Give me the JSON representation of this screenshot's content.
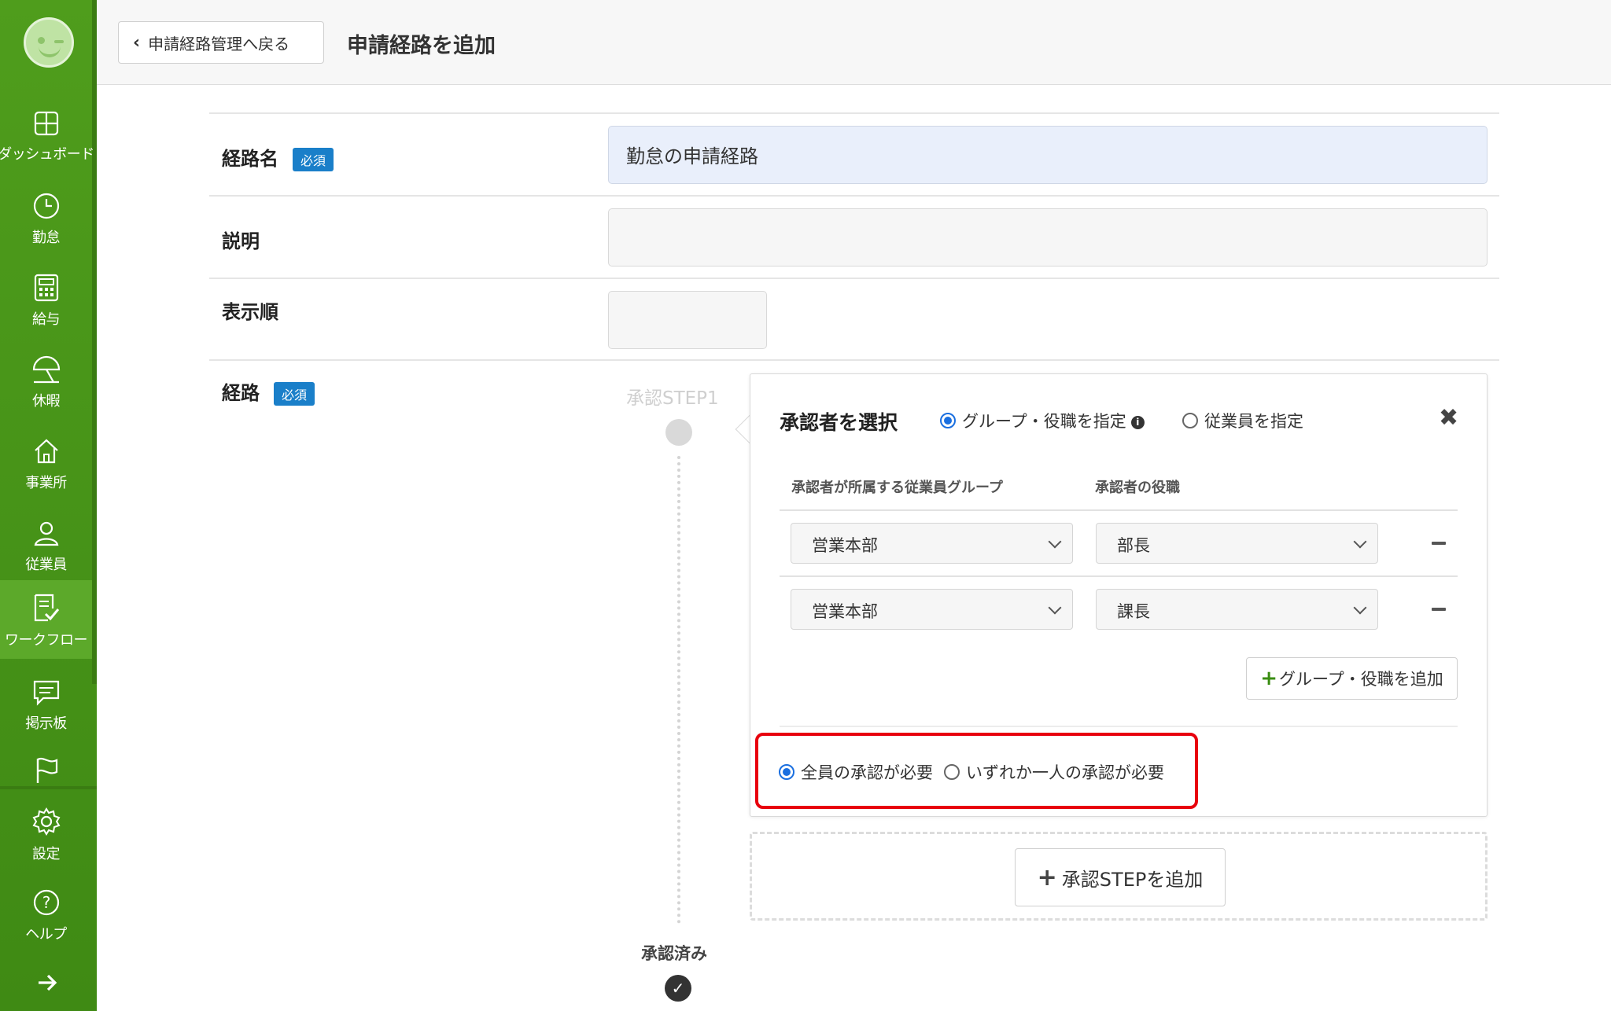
{
  "sidebar": {
    "items": [
      {
        "label": "ダッシュボード",
        "icon": "dashboard-icon"
      },
      {
        "label": "勤怠",
        "icon": "clock-icon"
      },
      {
        "label": "給与",
        "icon": "calculator-icon"
      },
      {
        "label": "休暇",
        "icon": "umbrella-icon"
      },
      {
        "label": "事業所",
        "icon": "home-icon"
      },
      {
        "label": "従業員",
        "icon": "person-icon"
      },
      {
        "label": "ワークフロー",
        "icon": "workflow-icon"
      },
      {
        "label": "掲示板",
        "icon": "message-icon"
      },
      {
        "label": "設定",
        "icon": "gear-icon"
      },
      {
        "label": "ヘルプ",
        "icon": "help-icon"
      }
    ],
    "active": "ワークフロー",
    "expand_icon": "arrow-right-icon"
  },
  "header": {
    "back_label": "申請経路管理へ戻る",
    "title": "申請経路を追加"
  },
  "form": {
    "route_name_label": "経路名",
    "required_badge": "必須",
    "route_name_value": "勤怠の申請経路",
    "description_label": "説明",
    "description_value": "",
    "order_label": "表示順",
    "order_value": "",
    "route_label": "経路"
  },
  "route": {
    "step_label": "承認STEP1",
    "done_label": "承認済み"
  },
  "approver_panel": {
    "title": "承認者を選択",
    "option_group": "グループ・役職を指定",
    "option_employee": "従業員を指定",
    "selected_option": "グループ・役職を指定",
    "col_group": "承認者が所属する従業員グループ",
    "col_role": "承認者の役職",
    "rows": [
      {
        "group": "営業本部",
        "role": "部長"
      },
      {
        "group": "営業本部",
        "role": "課長"
      }
    ],
    "add_group_label": "グループ・役職を追加",
    "approval_all": "全員の承認が必要",
    "approval_any": "いずれか一人の承認が必要",
    "selected_approval": "全員の承認が必要"
  },
  "add_step_label": "承認STEPを追加",
  "colors": {
    "sidebar": "#4f9d1c",
    "badge": "#1a7fc9",
    "radio": "#1a6fe0",
    "highlight": "#e8000d"
  }
}
